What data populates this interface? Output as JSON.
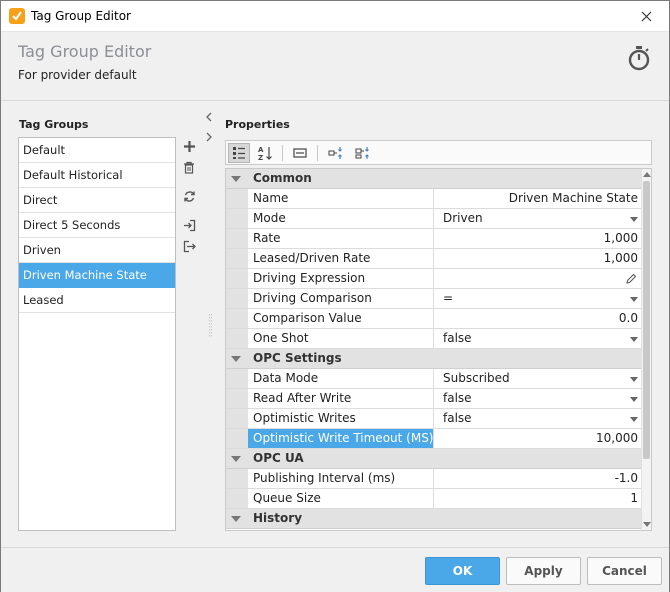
{
  "window": {
    "title": "Tag Group Editor"
  },
  "header": {
    "title": "Tag Group Editor",
    "subtitle": "For provider default"
  },
  "tag_groups": {
    "label": "Tag Groups",
    "items": [
      "Default",
      "Default Historical",
      "Direct",
      "Direct 5 Seconds",
      "Driven",
      "Driven Machine State",
      "Leased"
    ],
    "selected": "Driven Machine State"
  },
  "properties": {
    "label": "Properties",
    "categories": [
      {
        "name": "Common",
        "rows": [
          {
            "name": "Name",
            "value": "Driven Machine State",
            "align": "right"
          },
          {
            "name": "Mode",
            "value": "Driven",
            "align": "left",
            "dropdown": true
          },
          {
            "name": "Rate",
            "value": "1,000",
            "align": "right"
          },
          {
            "name": "Leased/Driven Rate",
            "value": "1,000",
            "align": "right"
          },
          {
            "name": "Driving Expression",
            "value": "",
            "align": "right",
            "editor": true
          },
          {
            "name": "Driving Comparison",
            "value": "=",
            "align": "left",
            "dropdown": true
          },
          {
            "name": "Comparison Value",
            "value": "0.0",
            "align": "right"
          },
          {
            "name": "One Shot",
            "value": "false",
            "align": "left",
            "dropdown": true
          }
        ]
      },
      {
        "name": "OPC Settings",
        "rows": [
          {
            "name": "Data Mode",
            "value": "Subscribed",
            "align": "left",
            "dropdown": true
          },
          {
            "name": "Read After Write",
            "value": "false",
            "align": "left",
            "dropdown": true
          },
          {
            "name": "Optimistic Writes",
            "value": "false",
            "align": "left",
            "dropdown": true
          },
          {
            "name": "Optimistic Write Timeout (MS)",
            "value": "10,000",
            "align": "right",
            "selected": true
          }
        ]
      },
      {
        "name": "OPC UA",
        "rows": [
          {
            "name": "Publishing Interval (ms)",
            "value": "-1.0",
            "align": "right"
          },
          {
            "name": "Queue Size",
            "value": "1",
            "align": "right"
          }
        ]
      },
      {
        "name": "History",
        "rows": []
      }
    ]
  },
  "footer": {
    "ok_label": "OK",
    "apply_label": "Apply",
    "cancel_label": "Cancel"
  },
  "colors": {
    "accent": "#4aa7e8",
    "app_icon": "#f7a11a"
  }
}
